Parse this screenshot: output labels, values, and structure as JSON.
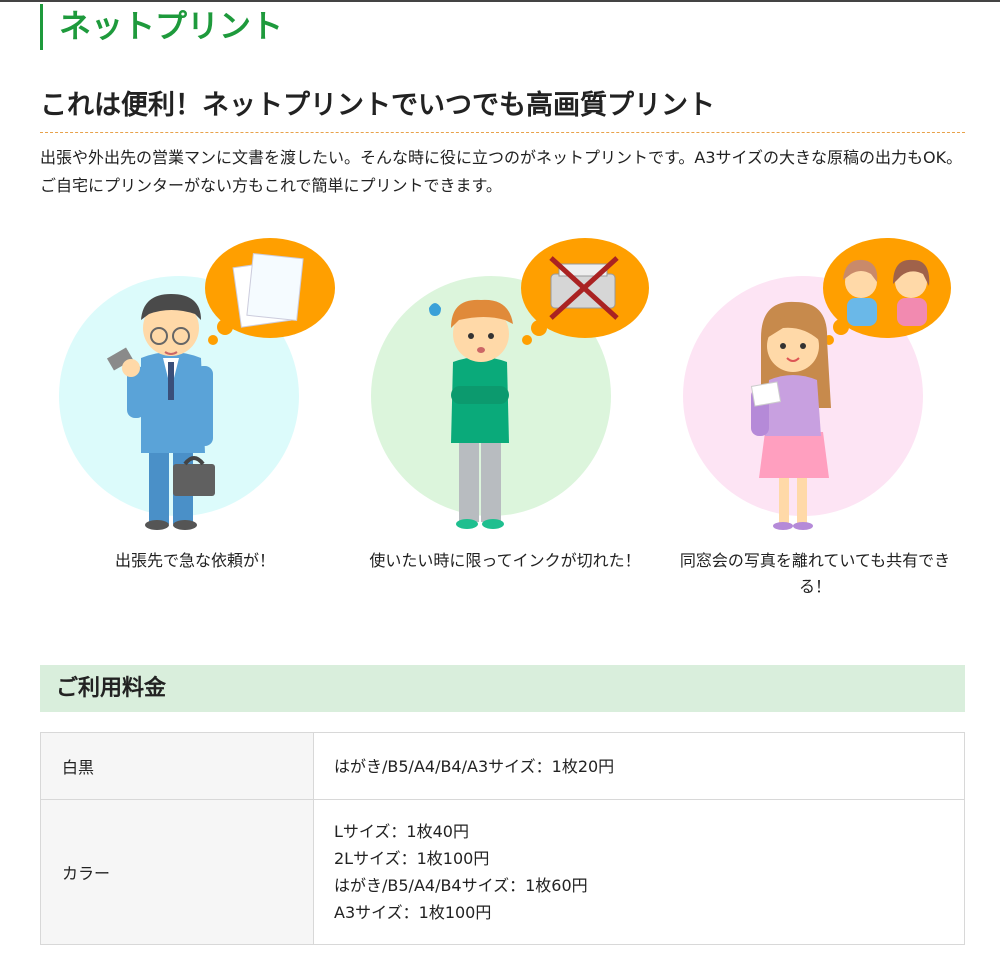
{
  "page_title": "ネットプリント",
  "subhead": "これは便利！ネットプリントでいつでも高画質プリント",
  "intro": "出張や外出先の営業マンに文書を渡したい。そんな時に役に立つのがネットプリントです。A3サイズの大きな原稿の出力もOK。ご自宅にプリンターがない方もこれで簡単にプリントできます。",
  "features": [
    {
      "caption": "出張先で急な依頼が！",
      "circle_color": "#dcfbfb"
    },
    {
      "caption": "使いたい時に限ってインクが切れた！",
      "circle_color": "#dcf5dc"
    },
    {
      "caption": "同窓会の写真を離れていても共有できる！",
      "circle_color": "#fde4f4"
    }
  ],
  "bubble_color": "#ff9f00",
  "accent_color": "#1e9a3c",
  "pricing": {
    "title": "ご利用料金",
    "rows": [
      {
        "label": "白黒",
        "lines": [
          "はがき/B5/A4/B4/A3サイズ：1枚20円"
        ]
      },
      {
        "label": "カラー",
        "lines": [
          "Lサイズ：1枚40円",
          "2Lサイズ：1枚100円",
          "はがき/B5/A4/B4サイズ：1枚60円",
          "A3サイズ：1枚100円"
        ]
      }
    ]
  }
}
